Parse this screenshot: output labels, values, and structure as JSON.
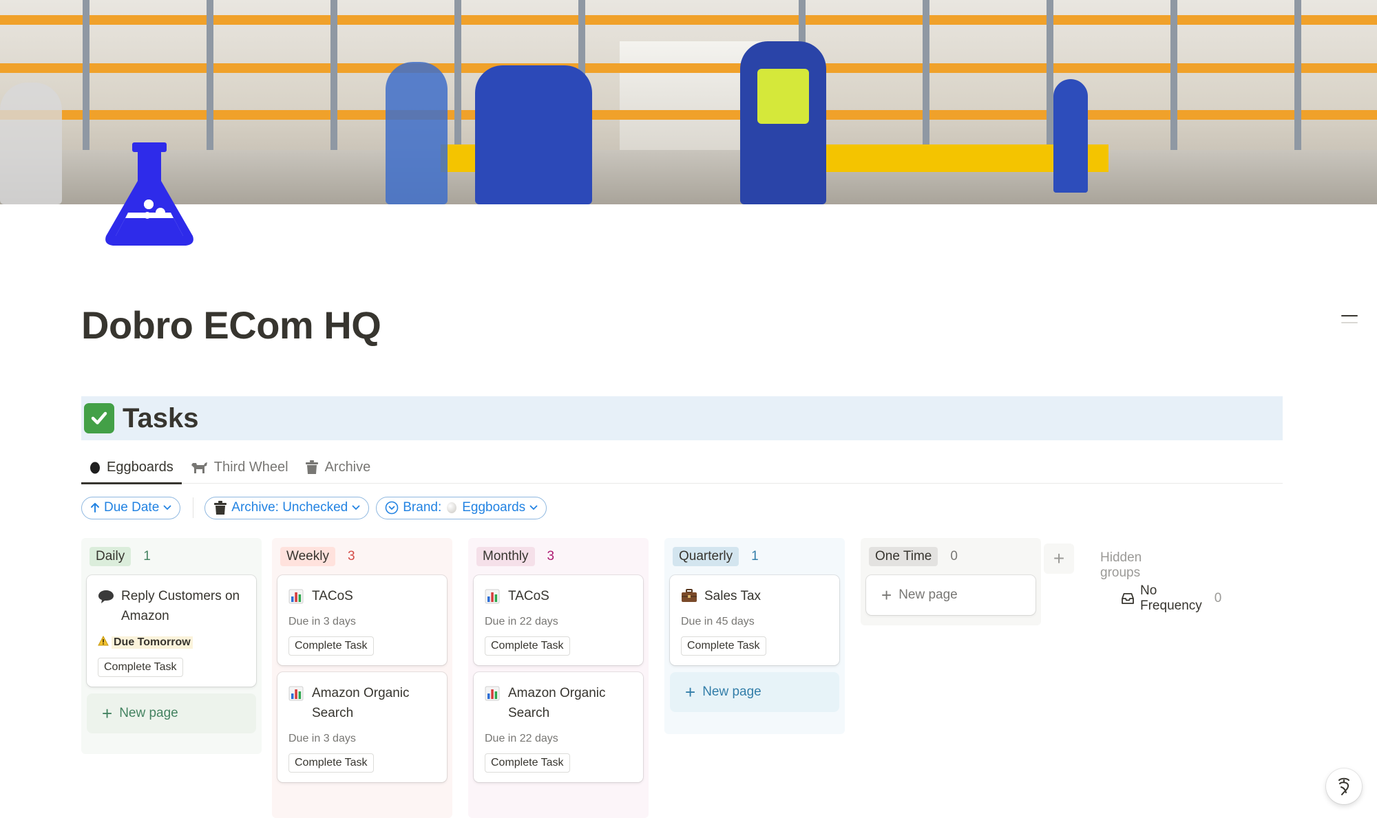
{
  "cover": {
    "image": "warehouse-cover-photo"
  },
  "page_icon": "flask-icon",
  "page": {
    "title": "Dobro ECom HQ"
  },
  "tasks_section": {
    "icon": "checkmark-icon",
    "heading": "Tasks"
  },
  "tabs": [
    {
      "label": "Eggboards",
      "icon": "egg-icon",
      "active": true
    },
    {
      "label": "Third Wheel",
      "icon": "dog-icon",
      "active": false
    },
    {
      "label": "Archive",
      "icon": "trash-icon",
      "active": false
    }
  ],
  "filters": {
    "sort": {
      "label": "Due Date",
      "icon": "arrow-up-icon"
    },
    "archive": {
      "label": "Archive: Unchecked",
      "icon": "trash-icon"
    },
    "brand": {
      "prefix": "Brand:",
      "value": "Eggboards",
      "icon": "chevron-circle-icon"
    }
  },
  "board": {
    "groups": [
      {
        "name": "Daily",
        "count": "1",
        "color": "#448361",
        "cards": [
          {
            "icon": "speech-bubble-icon",
            "title": "Reply Customers on Amazon",
            "warning": "Due Tomorrow",
            "button": "Complete Task"
          }
        ],
        "new_page": "New page"
      },
      {
        "name": "Weekly",
        "count": "3",
        "color": "#d44c47",
        "cards": [
          {
            "icon": "bar-chart-icon",
            "title": "TACoS",
            "due": "Due in 3 days",
            "button": "Complete Task"
          },
          {
            "icon": "bar-chart-icon",
            "title": "Amazon Organic Search",
            "due": "Due in 3 days",
            "button": "Complete Task"
          }
        ]
      },
      {
        "name": "Monthly",
        "count": "3",
        "color": "#ad1a72",
        "cards": [
          {
            "icon": "bar-chart-icon",
            "title": "TACoS",
            "due": "Due in 22 days",
            "button": "Complete Task"
          },
          {
            "icon": "bar-chart-icon",
            "title": "Amazon Organic Search",
            "due": "Due in 22 days",
            "button": "Complete Task"
          }
        ]
      },
      {
        "name": "Quarterly",
        "count": "1",
        "color": "#337ea9",
        "cards": [
          {
            "icon": "briefcase-icon",
            "title": "Sales Tax",
            "due": "Due in 45 days",
            "button": "Complete Task"
          }
        ],
        "new_page": "New page"
      },
      {
        "name": "One Time",
        "count": "0",
        "color": "#787774",
        "cards": [],
        "new_page": "New page"
      }
    ],
    "add_group_icon": "plus-icon",
    "hidden_groups": {
      "label": "Hidden groups",
      "items": [
        {
          "name": "No Frequency",
          "count": "0",
          "icon": "inbox-icon"
        }
      ]
    }
  },
  "help_icon": "notion-ai-icon"
}
